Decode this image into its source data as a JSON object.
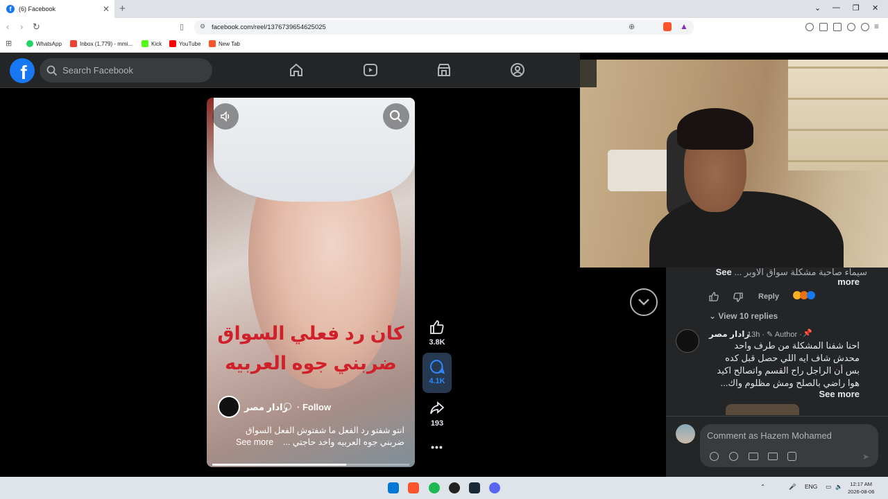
{
  "browser": {
    "tab_title": "(6) Facebook",
    "url": "facebook.com/reel/1376739654625025",
    "bookmarks": [
      "WhatsApp",
      "Inbox (1,779) - mmi...",
      "Kick",
      "YouTube",
      "New Tab"
    ]
  },
  "facebook": {
    "logo": "f",
    "search_placeholder": "Search Facebook",
    "nav_icons": [
      "home-icon",
      "video-icon",
      "marketplace-icon",
      "groups-icon"
    ]
  },
  "reel": {
    "caption_line1": "كان رد فعلي السواق",
    "caption_line2": "ضربني جوه العربيه",
    "page_name": "رادار مصر",
    "follow_label": "· Follow",
    "description_line1": "انتو شفتو رد الفعل ما شفتوش الفعل السواق",
    "description_line2": "ضربني جوه العربيه واخد حاجتي ...",
    "see_more": "See more",
    "progress": 0.68,
    "likes": "3.8K",
    "comments": "4.1K",
    "shares": "193",
    "more": "•••"
  },
  "comments": {
    "partial_text": "سيماء صاحبة مشكلة سواق الاوبر ...",
    "partial_see": "See",
    "partial_more": "more",
    "reply_label": "Reply",
    "view_replies": "View 10 replies",
    "author_name": "رادار مصر",
    "author_meta": "13h · ✎ Author ·",
    "author_lines": [
      "احنا شفنا المشكلة من طرف واحد",
      "محدش شاف ايه اللي حصل قبل كده",
      "بس أن الراجل راح القسم واتصالح اكيد",
      "هوا راضي بالصلح ومش مظلوم واك..."
    ],
    "author_see_more": "See more",
    "input_placeholder": "Comment as Hazem Mohamed"
  },
  "taskbar": {
    "lang": "ENG",
    "time": "12:17 AM",
    "date": "2026-08-06"
  },
  "colors": {
    "fb_blue": "#1877f2",
    "fb_dark": "#242526",
    "caption_red": "#d0202a"
  }
}
